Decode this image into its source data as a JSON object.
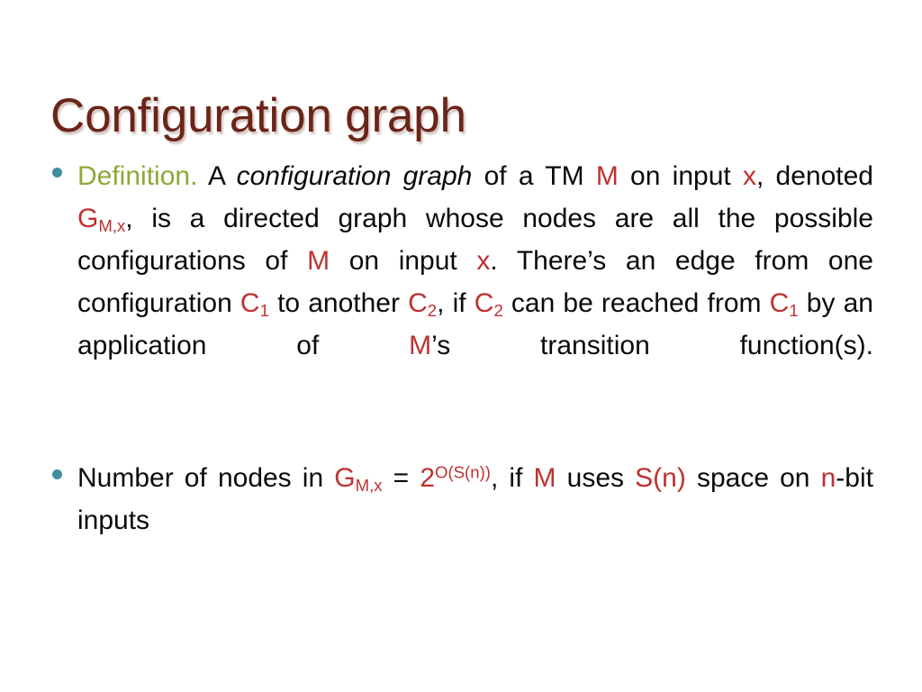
{
  "slide": {
    "title": "Configuration graph",
    "background_color": "#ffffff",
    "title_color": "#6b2418",
    "accent_colors": {
      "bullet": "#3d8fa0",
      "definition_green": "#8ca838",
      "symbol_red": "#be3131",
      "body_black": "#0a0a0a"
    }
  },
  "bullets": [
    {
      "id": "definition",
      "marker": "bullet-dot",
      "segments": [
        {
          "text": "Definition.",
          "style": "green"
        },
        {
          "text": "  A ",
          "style": "plain"
        },
        {
          "text": "configuration graph",
          "style": "italic"
        },
        {
          "text": " of a TM ",
          "style": "plain"
        },
        {
          "text": "M",
          "style": "red"
        },
        {
          "text": " on input ",
          "style": "plain"
        },
        {
          "text": "x",
          "style": "red"
        },
        {
          "text": ", denoted ",
          "style": "plain"
        },
        {
          "text": "G",
          "style": "red",
          "sub": "M,x"
        },
        {
          "text": ", is a directed graph whose nodes are all the possible configurations of ",
          "style": "plain"
        },
        {
          "text": "M",
          "style": "red"
        },
        {
          "text": " on input ",
          "style": "plain"
        },
        {
          "text": "x",
          "style": "red"
        },
        {
          "text": ". There’s an edge from one configuration ",
          "style": "plain"
        },
        {
          "text": "C",
          "style": "red",
          "sub": "1"
        },
        {
          "text": " to another ",
          "style": "plain"
        },
        {
          "text": "C",
          "style": "red",
          "sub": "2"
        },
        {
          "text": ", if ",
          "style": "plain"
        },
        {
          "text": "C",
          "style": "red",
          "sub": "2"
        },
        {
          "text": " can be reached from ",
          "style": "plain"
        },
        {
          "text": "C",
          "style": "red",
          "sub": "1"
        },
        {
          "text": " by an application of ",
          "style": "plain"
        },
        {
          "text": "M",
          "style": "red"
        },
        {
          "text": "’s transition function(s).",
          "style": "plain"
        }
      ],
      "plain_text": "Definition.  A configuration graph of a TM M on input x, denoted G_M,x, is a directed graph whose nodes are all the possible configurations of M on input x. There’s an edge from one configuration C_1 to another C_2, if C_2 can be reached from C_1 by an application of M’s transition function(s)."
    },
    {
      "id": "node-count",
      "marker": "bullet-dot",
      "segments": [
        {
          "text": "Number of nodes in ",
          "style": "plain"
        },
        {
          "text": "G",
          "style": "red",
          "sub": "M,x"
        },
        {
          "text": " = ",
          "style": "plain"
        },
        {
          "text": "2",
          "style": "red",
          "sup": "O(S(n))"
        },
        {
          "text": ", if ",
          "style": "plain"
        },
        {
          "text": "M",
          "style": "red"
        },
        {
          "text": " uses ",
          "style": "plain"
        },
        {
          "text": "S(n)",
          "style": "red"
        },
        {
          "text": " space on ",
          "style": "plain"
        },
        {
          "text": "n",
          "style": "red"
        },
        {
          "text": "-bit inputs",
          "style": "plain"
        }
      ],
      "plain_text": "Number of nodes in G_M,x = 2^O(S(n)), if M uses S(n) space on n-bit inputs"
    }
  ],
  "text_fragments": {
    "definition_label": "Definition.",
    "a_space": "  A ",
    "configuration_graph_italic": "configuration graph",
    "of_a_tm": " of a TM ",
    "M_1": "M",
    "on_input_1": " on input ",
    "x_1": "x",
    "comma_denoted": ", denoted ",
    "G_1": "G",
    "G_1_sub": "M,x",
    "is_directed": ", is a directed graph whose nodes are all the possible configurations of ",
    "M_2": "M",
    "on_input_2": " on input ",
    "x_2": "x",
    "theres_an_edge": ". There’s an edge from one configuration ",
    "C_a": "C",
    "C_a_sub": "1",
    "to_another": " to another ",
    "C_b": "C",
    "C_b_sub": "2",
    "comma_if": ", if ",
    "C_c": "C",
    "C_c_sub": "2",
    "can_be_reached": " can be reached from ",
    "C_d": "C",
    "C_d_sub": "1",
    "by_application": " by an application of ",
    "M_3": "M",
    "transition_fn": "’s transition function(s).",
    "number_of_nodes": "Number of nodes in ",
    "G_2": "G",
    "G_2_sub": "M,x",
    "equals": " = ",
    "two": "2",
    "two_sup": "O(S(n))",
    "comma_if_2": ", if ",
    "M_4": "M",
    "uses": " uses ",
    "Sn": "S(n)",
    "space_on": " space on ",
    "n": "n",
    "bit_inputs": "-bit inputs"
  }
}
